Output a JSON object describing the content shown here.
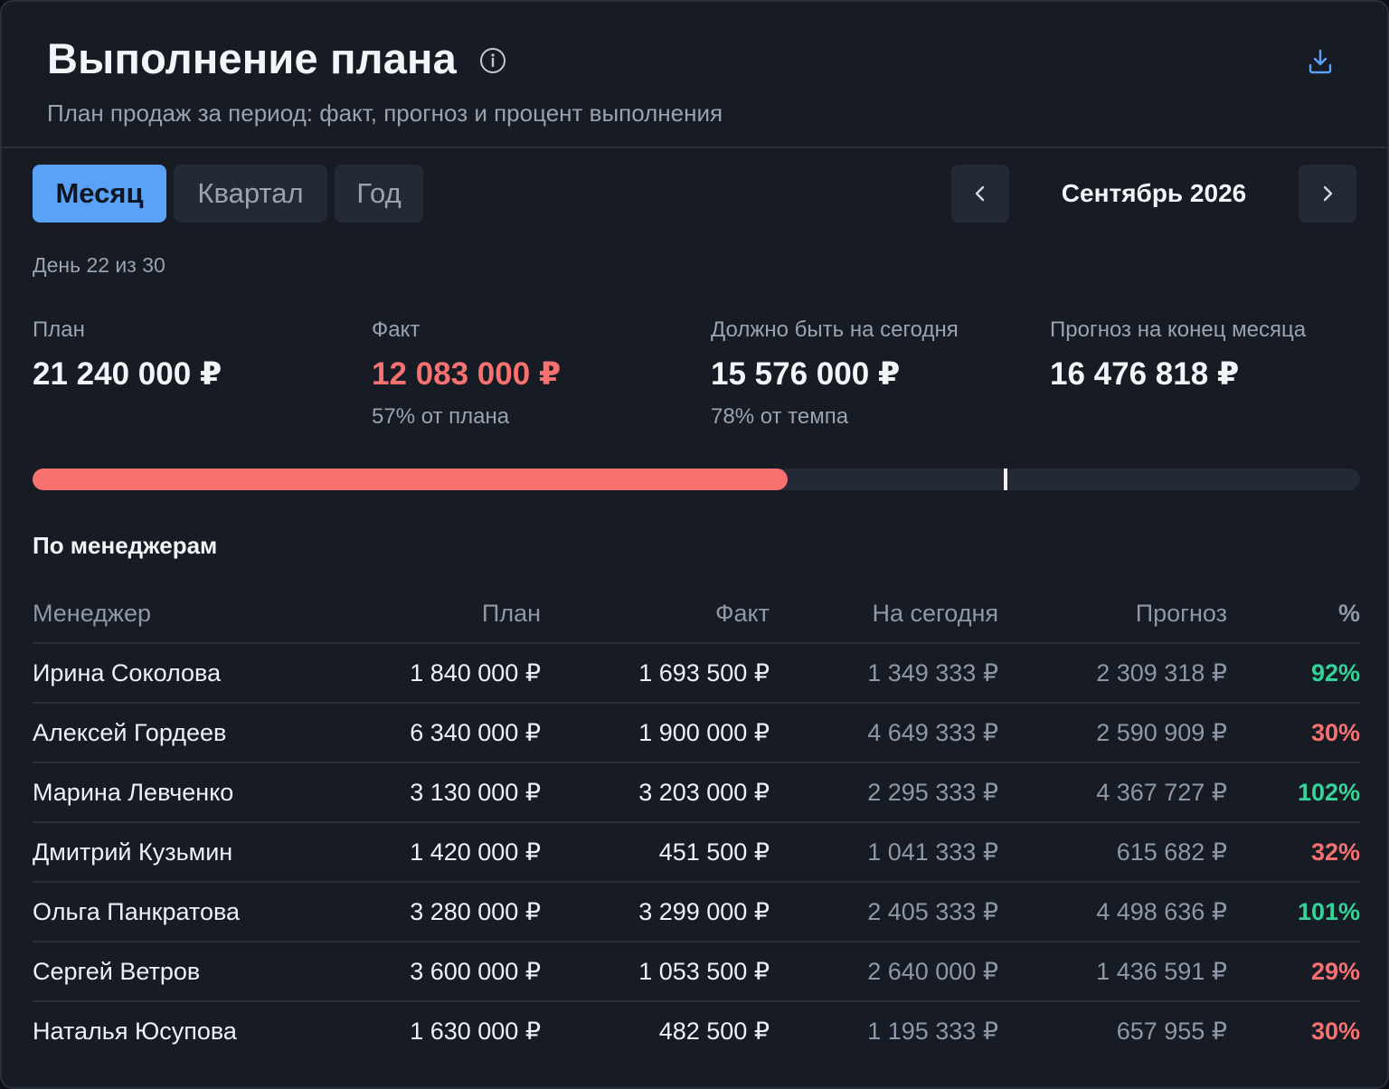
{
  "header": {
    "title": "Выполнение плана",
    "subtitle": "План продаж за период: факт, прогноз и процент выполнения",
    "info_icon": "info-icon",
    "download_icon": "download-icon"
  },
  "tabs": [
    {
      "label": "Месяц",
      "active": true
    },
    {
      "label": "Квартал",
      "active": false
    },
    {
      "label": "Год",
      "active": false
    }
  ],
  "period": {
    "label": "Сентябрь 2026",
    "prev_icon": "chevron-left-icon",
    "next_icon": "chevron-right-icon"
  },
  "day_info": "День 22 из 30",
  "kpis": {
    "plan": {
      "label": "План",
      "value": "21 240 000 ₽"
    },
    "fact": {
      "label": "Факт",
      "value": "12 083 000 ₽",
      "sub": "57% от плана"
    },
    "expected": {
      "label": "Должно быть на сегодня",
      "value": "15 576 000 ₽",
      "sub": "78% от темпа"
    },
    "forecast": {
      "label": "Прогноз на конец месяца",
      "value": "16 476 818 ₽"
    }
  },
  "progress": {
    "fact_fraction": 0.569,
    "expected_fraction": 0.733
  },
  "colors": {
    "accent": "#5aa2f7",
    "bad": "#f87171",
    "good": "#34d399",
    "background": "#161b24"
  },
  "managers": {
    "title": "По менеджерам",
    "columns": {
      "name": "Менеджер",
      "plan": "План",
      "fact": "Факт",
      "today": "На сегодня",
      "forecast": "Прогноз",
      "pct": "%"
    },
    "rows": [
      {
        "name": "Ирина Соколова",
        "plan": "1 840 000 ₽",
        "fact": "1 693 500 ₽",
        "today": "1 349 333 ₽",
        "forecast": "2 309 318 ₽",
        "pct": "92%",
        "status": "good"
      },
      {
        "name": "Алексей Гордеев",
        "plan": "6 340 000 ₽",
        "fact": "1 900 000 ₽",
        "today": "4 649 333 ₽",
        "forecast": "2 590 909 ₽",
        "pct": "30%",
        "status": "bad"
      },
      {
        "name": "Марина Левченко",
        "plan": "3 130 000 ₽",
        "fact": "3 203 000 ₽",
        "today": "2 295 333 ₽",
        "forecast": "4 367 727 ₽",
        "pct": "102%",
        "status": "good"
      },
      {
        "name": "Дмитрий Кузьмин",
        "plan": "1 420 000 ₽",
        "fact": "451 500 ₽",
        "today": "1 041 333 ₽",
        "forecast": "615 682 ₽",
        "pct": "32%",
        "status": "bad"
      },
      {
        "name": "Ольга Панкратова",
        "plan": "3 280 000 ₽",
        "fact": "3 299 000 ₽",
        "today": "2 405 333 ₽",
        "forecast": "4 498 636 ₽",
        "pct": "101%",
        "status": "good"
      },
      {
        "name": "Сергей Ветров",
        "plan": "3 600 000 ₽",
        "fact": "1 053 500 ₽",
        "today": "2 640 000 ₽",
        "forecast": "1 436 591 ₽",
        "pct": "29%",
        "status": "bad"
      },
      {
        "name": "Наталья Юсупова",
        "plan": "1 630 000 ₽",
        "fact": "482 500 ₽",
        "today": "1 195 333 ₽",
        "forecast": "657 955 ₽",
        "pct": "30%",
        "status": "bad"
      }
    ]
  }
}
